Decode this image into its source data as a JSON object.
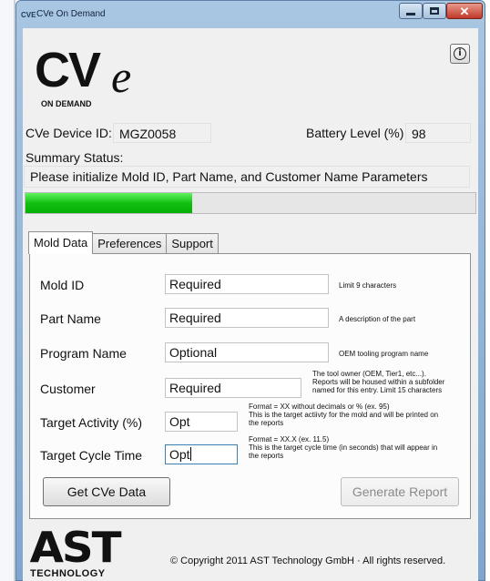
{
  "window": {
    "title": "CVe On Demand",
    "icon_text": "CVE"
  },
  "logo": {
    "main": "CV",
    "accent": "e",
    "sub": "ON DEMAND"
  },
  "info_button": {
    "glyph": "i"
  },
  "device": {
    "id_label": "CVe Device ID:",
    "id_value": "MGZ0058",
    "battery_label": "Battery Level (%)",
    "battery_value": "98"
  },
  "summary": {
    "label": "Summary Status:",
    "message": "Please initialize Mold ID, Part Name, and Customer Name Parameters"
  },
  "progress": {
    "fraction": 0.37,
    "color": "#11c011"
  },
  "tabs": [
    {
      "label": "Mold Data",
      "active": true
    },
    {
      "label": "Preferences",
      "active": false
    },
    {
      "label": "Support",
      "active": false
    }
  ],
  "fields": [
    {
      "label": "Mold ID",
      "value": "Required",
      "hint": "Limit 9 characters"
    },
    {
      "label": "Part Name",
      "value": "Required",
      "hint": "A description of the part"
    },
    {
      "label": "Program Name",
      "value": "Optional",
      "hint": "OEM tooling program name"
    },
    {
      "label": "Customer",
      "value": "Required",
      "hint": "The tool owner (OEM, Tier1, etc...).\nReports will be housed within a subfolder\nnamed for this entry. Limit 15 characters"
    },
    {
      "label": "Target Activity (%)",
      "value": "Opt",
      "hint": "Format = XX without decimals or % (ex. 95)\nThis is the target actiivty for the mold and will be printed on\nthe reports"
    },
    {
      "label": "Target Cycle Time",
      "value": "Opt",
      "hint": "Format = XX.X (ex. 11.5)\nThis is the target cycle time (in seconds) that will appear in\nthe reports"
    }
  ],
  "buttons": {
    "get_data": "Get CVe Data",
    "generate_report": "Generate Report"
  },
  "footer": {
    "ast_main": "AST",
    "ast_sub": "TECHNOLOGY",
    "copyright": "© Copyright 2011 AST Technology GmbH · All rights reserved."
  },
  "colors": {
    "window_frame": "#7ea6cf",
    "close_button": "#c0392b",
    "progress_fill": "#11c011"
  }
}
